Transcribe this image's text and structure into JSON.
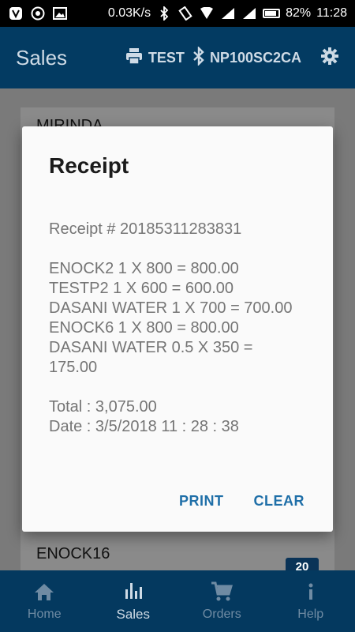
{
  "status_bar": {
    "speed": "0.03K/s",
    "battery_percent": "82%",
    "time": "11:28"
  },
  "app_bar": {
    "title": "Sales",
    "printer_label": "TEST",
    "bluetooth_device": "NP100SC2CA"
  },
  "list": {
    "items": [
      "MIRINDA",
      "ENOCK16"
    ],
    "badge": "20"
  },
  "dialog": {
    "title": "Receipt",
    "receipt_number": "Receipt # 20185311283831",
    "lines": [
      "ENOCK2 1 X 800 = 800.00",
      "TESTP2 1 X 600 = 600.00",
      "DASANI WATER 1 X 700 = 700.00",
      "ENOCK6 1 X 800 = 800.00",
      "DASANI WATER 0.5 X 350 =",
      "175.00"
    ],
    "total": "Total : 3,075.00",
    "date": "Date : 3/5/2018 11 : 28 : 38",
    "print_label": "PRINT",
    "clear_label": "CLEAR"
  },
  "bottom_nav": {
    "items": [
      {
        "label": "Home",
        "icon": "home-icon"
      },
      {
        "label": "Sales",
        "icon": "bar-chart-icon"
      },
      {
        "label": "Orders",
        "icon": "cart-icon"
      },
      {
        "label": "Help",
        "icon": "info-icon"
      }
    ],
    "active_index": 1
  },
  "colors": {
    "primary": "#033b62",
    "accent": "#1f6fa8",
    "dialog_text": "#757575"
  }
}
